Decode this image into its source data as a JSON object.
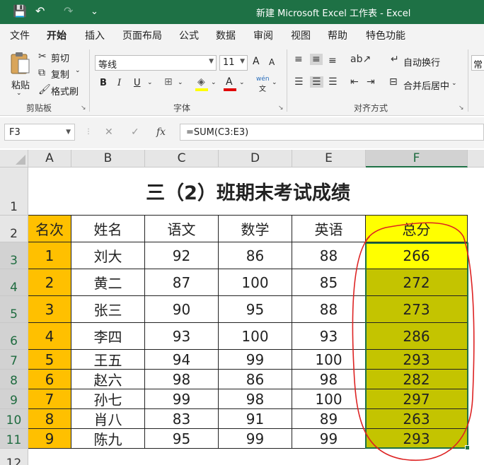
{
  "titlebar": {
    "title": "新建 Microsoft Excel 工作表  -  Excel",
    "save_icon": "💾",
    "undo_icon": "↶",
    "redo_icon": "↷",
    "customize_icon": "⌄"
  },
  "tabs": [
    "文件",
    "开始",
    "插入",
    "页面布局",
    "公式",
    "数据",
    "审阅",
    "视图",
    "帮助",
    "特色功能"
  ],
  "active_tab": "开始",
  "ribbon": {
    "clipboard": {
      "paste": "粘贴",
      "cut": "剪切",
      "copy": "复制",
      "format_painter": "格式刷",
      "label": "剪贴板"
    },
    "font": {
      "font_name": "等线",
      "font_size": "11",
      "grow": "A",
      "shrink": "A",
      "bold": "B",
      "italic": "I",
      "underline": "U",
      "phonetic": "wén",
      "label": "字体"
    },
    "alignment": {
      "wrap_text": "自动换行",
      "merge_center": "合并后居中",
      "label": "对齐方式"
    },
    "number_partial": "常"
  },
  "formula_bar": {
    "name_box": "F3",
    "cancel": "✕",
    "enter": "✓",
    "fx": "fx",
    "formula": "=SUM(C3:E3)"
  },
  "columns": [
    "A",
    "B",
    "C",
    "D",
    "E",
    "F"
  ],
  "rows": [
    "1",
    "2",
    "3",
    "4",
    "5",
    "6",
    "7",
    "8",
    "9",
    "10",
    "11",
    "12"
  ],
  "sheet": {
    "title": "三（2）班期末考试成绩",
    "headers": [
      "名次",
      "姓名",
      "语文",
      "数学",
      "英语",
      "总分"
    ],
    "data": [
      [
        "1",
        "刘大",
        "92",
        "86",
        "88",
        "266"
      ],
      [
        "2",
        "黄二",
        "87",
        "100",
        "85",
        "272"
      ],
      [
        "3",
        "张三",
        "90",
        "95",
        "88",
        "273"
      ],
      [
        "4",
        "李四",
        "93",
        "100",
        "93",
        "286"
      ],
      [
        "5",
        "王五",
        "94",
        "99",
        "100",
        "293"
      ],
      [
        "6",
        "赵六",
        "98",
        "86",
        "98",
        "282"
      ],
      [
        "7",
        "孙七",
        "99",
        "98",
        "100",
        "297"
      ],
      [
        "8",
        "肖八",
        "83",
        "91",
        "89",
        "263"
      ],
      [
        "9",
        "陈九",
        "95",
        "99",
        "99",
        "293"
      ]
    ]
  },
  "colors": {
    "excel_green": "#1e7145",
    "rank_fill": "#ffc000",
    "header_total_fill": "#ffff00",
    "total_fill": "#c4c400",
    "annotation": "#dd2222"
  }
}
